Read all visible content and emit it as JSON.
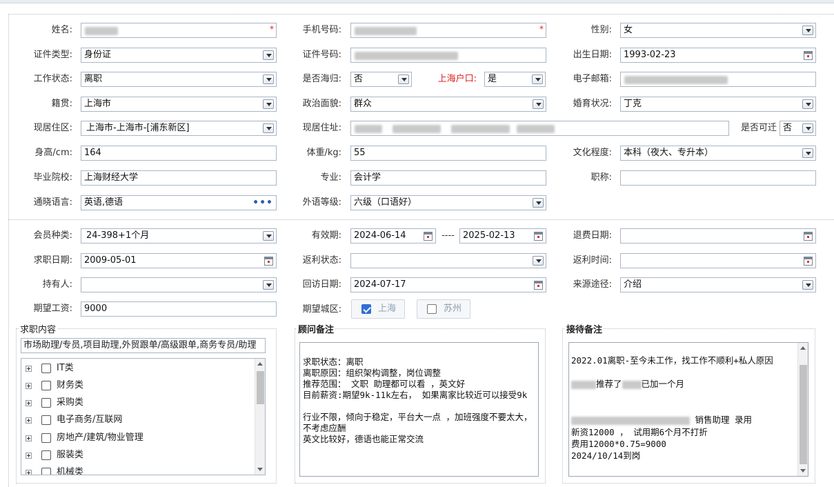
{
  "labels": {
    "name": "姓名:",
    "phone": "手机号码:",
    "gender": "性别:",
    "id_type": "证件类型:",
    "id_number": "证件号码:",
    "birthday": "出生日期:",
    "work_status": "工作状态:",
    "returnee": "是否海归:",
    "shanghai_hukou": "上海户口:",
    "email": "电子邮箱:",
    "native_place": "籍贯:",
    "political": "政治面貌:",
    "marital": "婚育状况:",
    "residence_area": "现居住区:",
    "residence_address": "现居住址:",
    "relocatable": "是否可迁",
    "height": "身高/cm:",
    "weight": "体重/kg:",
    "education": "文化程度:",
    "school": "毕业院校:",
    "major": "专业:",
    "title": "职称:",
    "languages": "通晓语言:",
    "lang_level": "外语等级:",
    "member_type": "会员种类:",
    "valid_period": "有效期:",
    "refund_date": "退费日期:",
    "job_date": "求职日期:",
    "rebate_status": "返利状态:",
    "rebate_time": "返利时间:",
    "holder": "持有人:",
    "visit_date": "回访日期:",
    "source": "来源途径:",
    "salary": "期望工资:",
    "city": "期望城区:",
    "range_sep": "----"
  },
  "values": {
    "gender": "女",
    "id_type": "身份证",
    "birthday": "1993-02-23",
    "work_status": "离职",
    "returnee": "否",
    "shanghai_hukou": "是",
    "native_place": "上海市",
    "political": "群众",
    "marital": "丁克",
    "residence_area": "上海市-上海市-[浦东新区]",
    "relocatable": "否",
    "height": "164",
    "weight": "55",
    "education": "本科（夜大、专升本）",
    "school": "上海财经大学",
    "major": "会计学",
    "title": "",
    "languages": "英语,德语",
    "lang_level": "六级（口语好）",
    "member_type": "24-398+1个月",
    "valid_from": "2024-06-14",
    "valid_to": "2025-02-13",
    "refund_date": "",
    "job_date": "2009-05-01",
    "rebate_status": "",
    "rebate_time": "",
    "holder": "",
    "visit_date": "2024-07-17",
    "source": "介绍",
    "salary": "9000"
  },
  "city_options": [
    {
      "label": "上海",
      "checked": true
    },
    {
      "label": "苏州",
      "checked": false
    }
  ],
  "job_content": {
    "title": "求职内容",
    "summary": "市场助理/专员,项目助理,外贸跟单/高级跟单,商务专员/助理",
    "tree": [
      "IT类",
      "财务类",
      "采购类",
      "电子商务/互联网",
      "房地产/建筑/物业管理",
      "服装类",
      "机械类"
    ]
  },
  "advisor_notes": {
    "title": "顾问备注",
    "text": "\n求职状态：离职\n离职原因：组织架构调整，岗位调整\n推荐范围： 文职 助理都可以看 ，英文好\n目前薪资:期望9k-11k左右， 如果离家比较近可以接受9k\n\n行业不限，倾向于稳定，平台大一点 ，加班强度不要太大，不考虑应酬\n英文比较好，德语也能正常交流"
  },
  "reception_notes": {
    "title": "接待备注",
    "line1": "2022.01离职-至今未工作，找工作不顺利+私人原因",
    "line2_suffix": "推荐了",
    "line2_end": "已加一个月",
    "line3_suffix": "销售助理  录用",
    "line4": "新资12000 ，  试用期6个月不打折",
    "line5": "费用12000*0.75=9000",
    "line6": "2024/10/14到岗"
  }
}
